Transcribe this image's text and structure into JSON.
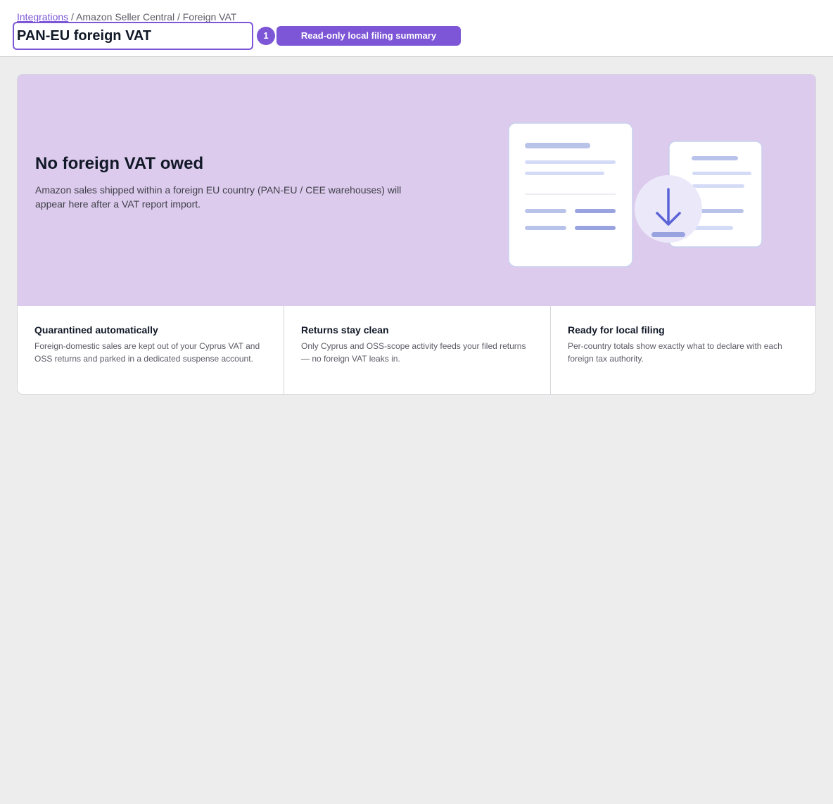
{
  "breadcrumb": {
    "link_label": "Integrations",
    "rest": " / Amazon Seller Central / Foreign VAT"
  },
  "header": {
    "title_value": "PAN-EU foreign VAT",
    "count_badge": "1",
    "mode_label": "Read-only local filing summary"
  },
  "hero": {
    "title": "No foreign VAT owed",
    "description": "Amazon sales shipped within a foreign EU country (PAN-EU / CEE warehouses) will appear here after a VAT report import.",
    "illustration_icon": "download-icon"
  },
  "features": [
    {
      "title": "Quarantined automatically",
      "text": "Foreign-domestic sales are kept out of your Cyprus VAT and OSS returns and parked in a dedicated suspense account."
    },
    {
      "title": "Returns stay clean",
      "text": "Only Cyprus and OSS-scope activity feeds your filed returns — no foreign VAT leaks in."
    },
    {
      "title": "Ready for local filing",
      "text": "Per-country totals show exactly what to declare with each foreign tax authority."
    }
  ],
  "colors": {
    "accent": "#7c56d6",
    "hero_background": "#dccbec",
    "page_background": "#ededed",
    "illustration_blue": "#5b64d6"
  }
}
